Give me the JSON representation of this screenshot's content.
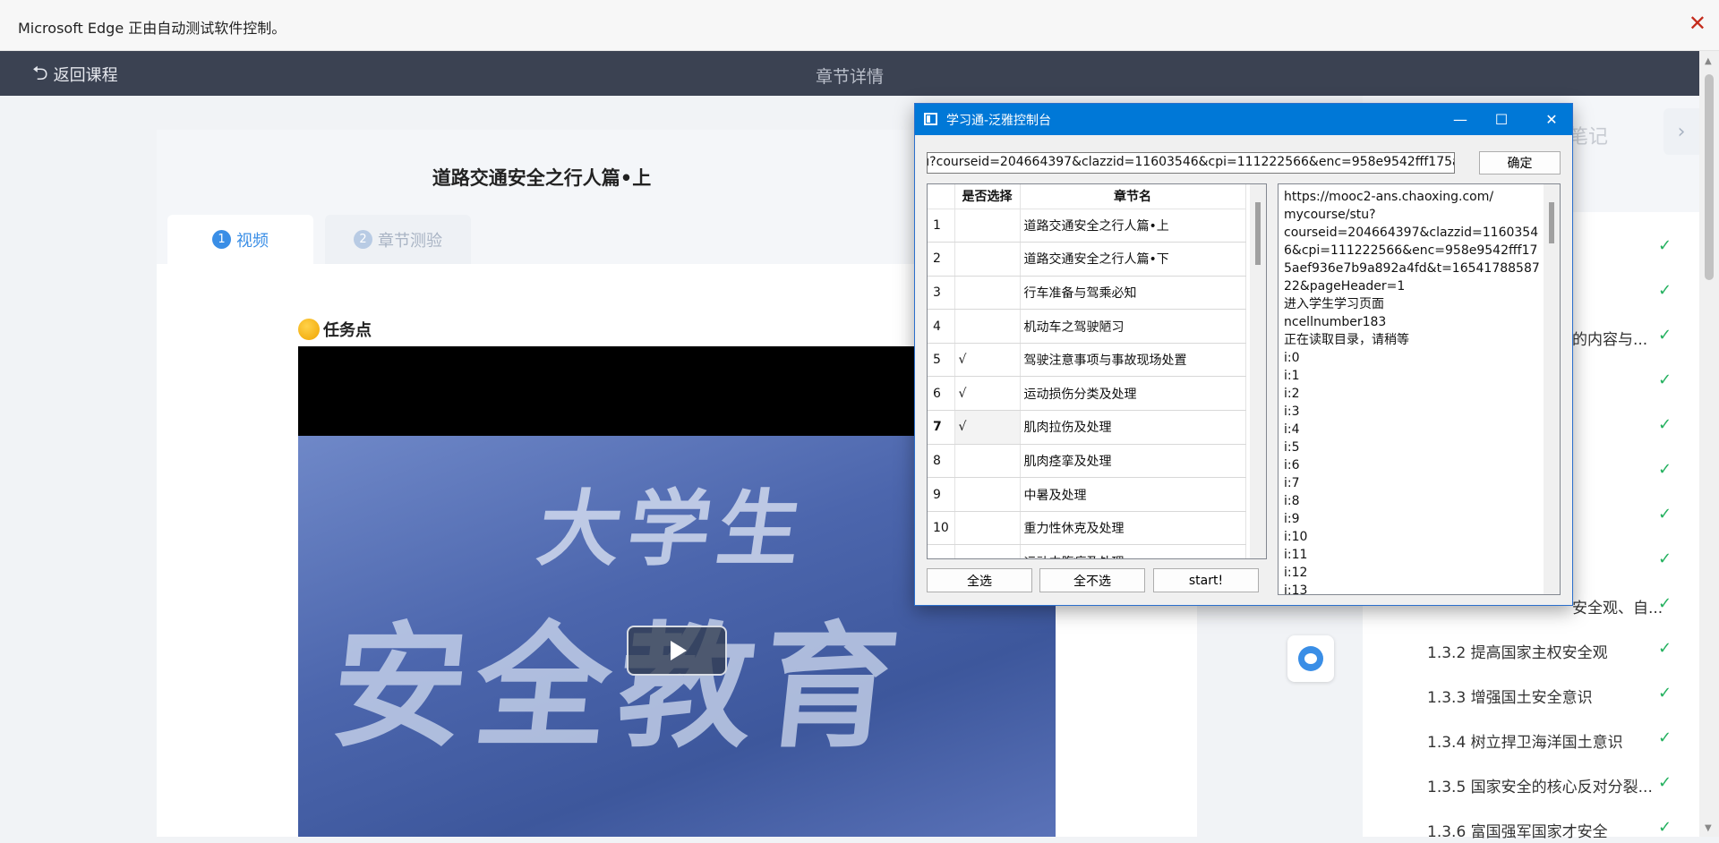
{
  "infobar": {
    "message": "Microsoft Edge 正由自动测试软件控制。",
    "close_glyph": "✕"
  },
  "header": {
    "back_label": "返回课程",
    "back_icon": "undo-arrow-icon",
    "title": "章节详情"
  },
  "lesson": {
    "title": "道路交通安全之行人篇•上",
    "tabs": [
      {
        "num": "1",
        "label": "视频"
      },
      {
        "num": "2",
        "label": "章节测验"
      }
    ],
    "taskpoint_label": "任务点",
    "video": {
      "overlay_line1": "大学生",
      "overlay_line2": "安全教育"
    }
  },
  "sidebar": {
    "note_label": "笔记",
    "chapters": [
      {
        "label": "",
        "done": true
      },
      {
        "label": "",
        "done": true
      },
      {
        "label": "的内容与...",
        "done": true
      },
      {
        "label": "",
        "done": true
      },
      {
        "label": "",
        "done": true
      },
      {
        "label": "",
        "done": true
      },
      {
        "label": "",
        "done": true
      },
      {
        "label": "",
        "done": true
      },
      {
        "label": "安全观、自...",
        "done": true
      },
      {
        "label": "1.3.2 提高国家主权安全观",
        "done": true
      },
      {
        "label": "1.3.3 增强国土安全意识",
        "done": true
      },
      {
        "label": "1.3.4 树立捍卫海洋国土意识",
        "done": true
      },
      {
        "label": "1.3.5 国家安全的核心反对分裂...",
        "done": true
      },
      {
        "label": "1.3.6 富国强军国家才安全",
        "done": true
      }
    ]
  },
  "console": {
    "title": "学习通-泛雅控制台",
    "url_value": "https://mooc2-ans.chaoxing.com/mycourse/stu?courseid=204664397&clazzid=11603546&cpi=111222566&enc=958e9542fff175aef936e7b9a892a4fd&t=1654178858722&pageHeader=1",
    "ok_label": "确定",
    "grid": {
      "headers": [
        "是否选择",
        "章节名"
      ],
      "rows": [
        {
          "n": "1",
          "sel": "",
          "name": "道路交通安全之行人篇•上"
        },
        {
          "n": "2",
          "sel": "",
          "name": "道路交通安全之行人篇•下"
        },
        {
          "n": "3",
          "sel": "",
          "name": "行车准备与驾乘必知"
        },
        {
          "n": "4",
          "sel": "",
          "name": "机动车之驾驶陋习"
        },
        {
          "n": "5",
          "sel": "√",
          "name": "驾驶注意事项与事故现场处置"
        },
        {
          "n": "6",
          "sel": "√",
          "name": "运动损伤分类及处理"
        },
        {
          "n": "7",
          "sel": "√",
          "name": "肌肉拉伤及处理"
        },
        {
          "n": "8",
          "sel": "",
          "name": "肌肉痉挛及处理"
        },
        {
          "n": "9",
          "sel": "",
          "name": "中暑及处理"
        },
        {
          "n": "10",
          "sel": "",
          "name": "重力性休克及处理"
        },
        {
          "n": "",
          "sel": "",
          "name": "运动中腹痛及处理"
        }
      ]
    },
    "log_lines": [
      "https://mooc2-ans.chaoxing.com/",
      "mycourse/stu?",
      "courseid=204664397&clazzid=1160354",
      "6&cpi=111222566&enc=958e9542fff17",
      "5aef936e7b9a892a4fd&t=16541788587",
      "22&pageHeader=1",
      "进入学生学习页面",
      "ncellnumber183",
      "正在读取目录，请稍等",
      "i:0",
      "i:1",
      "i:2",
      "i:3",
      "i:4",
      "i:5",
      "i:6",
      "i:7",
      "i:8",
      "i:9",
      "i:10",
      "i:11",
      "i:12",
      "i:13"
    ],
    "buttons": {
      "select_all": "全选",
      "select_none": "全不选",
      "start": "start!"
    }
  }
}
